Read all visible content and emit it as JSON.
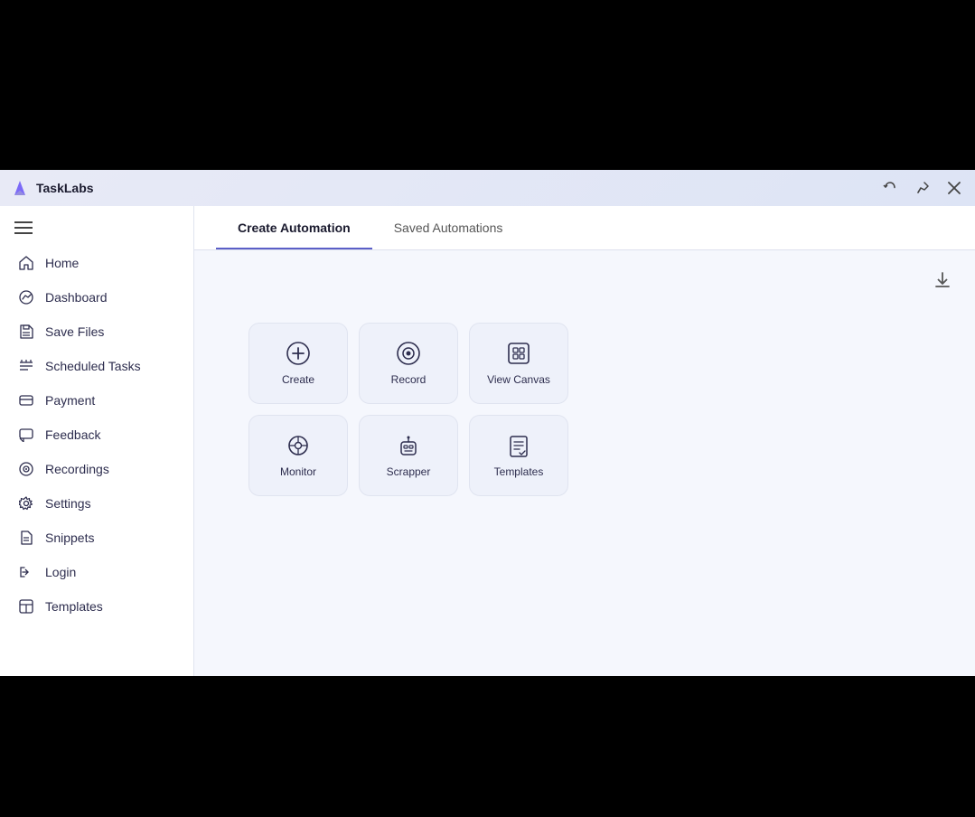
{
  "app": {
    "title": "TaskLabs",
    "logo_alt": "tasklabs-logo"
  },
  "titlebar": {
    "undo_label": "↩",
    "pin_label": "⊳",
    "close_label": "✕"
  },
  "sidebar": {
    "menu_icon": "≡",
    "items": [
      {
        "id": "home",
        "label": "Home",
        "icon": "home-icon"
      },
      {
        "id": "dashboard",
        "label": "Dashboard",
        "icon": "dashboard-icon"
      },
      {
        "id": "save-files",
        "label": "Save Files",
        "icon": "save-files-icon"
      },
      {
        "id": "scheduled-tasks",
        "label": "Scheduled Tasks",
        "icon": "scheduled-tasks-icon"
      },
      {
        "id": "payment",
        "label": "Payment",
        "icon": "payment-icon"
      },
      {
        "id": "feedback",
        "label": "Feedback",
        "icon": "feedback-icon"
      },
      {
        "id": "recordings",
        "label": "Recordings",
        "icon": "recordings-icon"
      },
      {
        "id": "settings",
        "label": "Settings",
        "icon": "settings-icon"
      },
      {
        "id": "snippets",
        "label": "Snippets",
        "icon": "snippets-icon"
      },
      {
        "id": "login",
        "label": "Login",
        "icon": "login-icon"
      },
      {
        "id": "templates",
        "label": "Templates",
        "icon": "templates-icon"
      }
    ]
  },
  "tabs": [
    {
      "id": "create-automation",
      "label": "Create Automation",
      "active": true
    },
    {
      "id": "saved-automations",
      "label": "Saved Automations",
      "active": false
    }
  ],
  "action_cards": {
    "row1": [
      {
        "id": "create",
        "label": "Create",
        "icon": "create-icon"
      },
      {
        "id": "record",
        "label": "Record",
        "icon": "record-icon"
      },
      {
        "id": "view-canvas",
        "label": "View Canvas",
        "icon": "view-canvas-icon"
      }
    ],
    "row2": [
      {
        "id": "monitor",
        "label": "Monitor",
        "icon": "monitor-icon"
      },
      {
        "id": "scrapper",
        "label": "Scrapper",
        "icon": "scrapper-icon"
      },
      {
        "id": "templates",
        "label": "Templates",
        "icon": "templates-card-icon"
      }
    ]
  },
  "toolbar": {
    "download_label": "⬇"
  }
}
